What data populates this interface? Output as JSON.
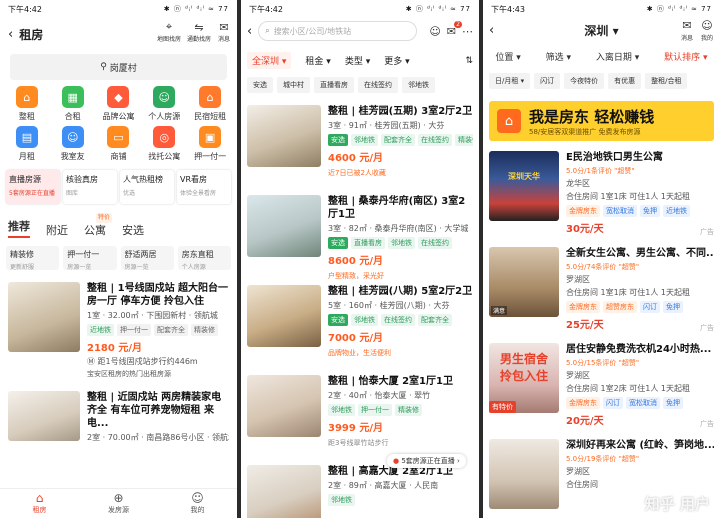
{
  "left": {
    "status": {
      "time": "下午4:42",
      "signal": "✱ ⓝ ᵈᵢˡ ᵈᵢˡ ≈ 77"
    },
    "title": "租房",
    "actions": [
      {
        "label": "地图找房"
      },
      {
        "label": "通勤找房"
      },
      {
        "label": "消息"
      }
    ],
    "search_text": "岗厦村",
    "categories": [
      {
        "label": "整租",
        "color": "#ff8a1f"
      },
      {
        "label": "合租",
        "color": "#3bbf5a"
      },
      {
        "label": "品牌公寓",
        "color": "#ff5a3a"
      },
      {
        "label": "个人房源",
        "color": "#2eaa5e"
      },
      {
        "label": "民宿短租",
        "color": "#ff7a2a"
      },
      {
        "label": "月租",
        "color": "#3d8ff5"
      },
      {
        "label": "我室友",
        "color": "#3d8ff5"
      },
      {
        "label": "商铺",
        "color": "#ff8a1f"
      },
      {
        "label": "找托公寓",
        "color": "#ff5a3a"
      },
      {
        "label": "押一付一",
        "color": "#ff8a1f"
      }
    ],
    "promo_cards": [
      {
        "title": "直播房源",
        "sub": "5套房源正在直播",
        "bg": "#ffe9ea"
      },
      {
        "title": "核验真房",
        "sub": "图库",
        "bg": "#fff"
      },
      {
        "title": "人气热租榜",
        "sub": "优选",
        "bg": "#fff"
      },
      {
        "title": "VR看房",
        "sub": "体验全景看房",
        "bg": "#fff"
      }
    ],
    "tabs": [
      {
        "label": "推荐"
      },
      {
        "label": "附近"
      },
      {
        "label": "公寓",
        "badge": "特价"
      },
      {
        "label": "安选"
      }
    ],
    "filters": [
      {
        "title": "精装修",
        "sub": "更新舒服"
      },
      {
        "title": "押一付一",
        "sub": "房源一览"
      },
      {
        "title": "舒适两居",
        "sub": "房源一览"
      },
      {
        "title": "房东直租",
        "sub": "个人房源"
      }
    ],
    "listings": [
      {
        "title": "整租 | 1号线固戍站  超大阳台一房一厅 停车方便 拎包入住",
        "meta": "1室 · 32.00㎡ · 下围园新村 · 领航城",
        "tags": [
          "近地铁",
          "押一付一",
          "配套齐全",
          "精装修"
        ],
        "price": "2180 元/月",
        "distance": "距1号线固戍站步行约446m",
        "note": "宝安区租房的热门出租房源"
      },
      {
        "title": "整租 | 近固戍站 两房精装家电齐全 有车位可养宠物短租 来电...",
        "meta": "2室 · 70.00㎡ · 南昌路86号小区 · 领航城",
        "tags": [],
        "price": "",
        "distance": "",
        "note": ""
      }
    ],
    "bottom_nav": [
      {
        "label": "租房",
        "icon": "⌂"
      },
      {
        "label": "发房源",
        "icon": "⊕"
      },
      {
        "label": "我的",
        "icon": "☺"
      }
    ]
  },
  "middle": {
    "status": {
      "time": "下午4:42",
      "signal": "✱ ⓝ ᵈᵢˡ ᵈᵢˡ ≈ 77"
    },
    "search_placeholder": "搜索小区/公司/地铁站",
    "msg_badge": "2",
    "filters": [
      {
        "label": "全深圳"
      },
      {
        "label": "租金"
      },
      {
        "label": "类型"
      },
      {
        "label": "更多"
      }
    ],
    "quick": [
      {
        "label": "安选"
      },
      {
        "label": "城中村"
      },
      {
        "label": "直播看房"
      },
      {
        "label": "在线签约"
      },
      {
        "label": "邻地铁"
      }
    ],
    "listings": [
      {
        "title": "整租 | 桂芳园(五期) 3室2厅2卫",
        "meta": "3室 · 91㎡ · 桂芳园(五期) · 大芬",
        "tags": [
          "安选",
          "邻地铁",
          "配套齐全",
          "在线签约",
          "精装修"
        ],
        "price": "4600 元/月",
        "note": "近7日已被2人收藏",
        "note_color": "#ff6a1f"
      },
      {
        "title": "整租 | 桑泰丹华府(南区) 3室2厅1卫",
        "meta": "3室 · 82㎡ · 桑泰丹华府(南区) · 大学城",
        "tags": [
          "安选",
          "直播看房",
          "邻地铁",
          "在线签约"
        ],
        "price": "8600 元/月",
        "note": "户型精致，采光好",
        "note_color": "#ff6a1f"
      },
      {
        "title": "整租 | 桂芳园(八期) 5室2厅2卫",
        "meta": "5室 · 160㎡ · 桂芳园(八期) · 大芬",
        "tags": [
          "安选",
          "邻地铁",
          "在线签约",
          "配套齐全"
        ],
        "price": "7000 元/月",
        "note": "品牌物业，生活便利",
        "note_color": "#ff6a1f"
      },
      {
        "title": "整租 | 怡泰大厦 2室1厅1卫",
        "meta": "2室 · 40㎡ · 怡泰大厦 · 翠竹",
        "tags": [
          "邻地铁",
          "押一付一",
          "精装修"
        ],
        "price": "3999 元/月",
        "note": "距3号线翠竹站步行",
        "note_color": "#888"
      },
      {
        "title": "整租 | 高嘉大厦 2室2厅1卫",
        "meta": "2室 · 89㎡ · 高嘉大厦 · 人民南",
        "tags": [
          "邻地铁"
        ],
        "price": "",
        "note": "",
        "note_color": "#888"
      }
    ],
    "live_float": "5套房源正在直播 ›"
  },
  "right": {
    "status": {
      "time": "下午4:43",
      "signal": "✱ ⓝ ᵈᵢˡ ᵈᵢˡ ≈ 77"
    },
    "city": "深圳 ▾",
    "actions": [
      {
        "label": "消息"
      },
      {
        "label": "我的"
      }
    ],
    "filters": [
      {
        "label": "位置 ▾"
      },
      {
        "label": "筛选 ▾"
      },
      {
        "label": "入离日期 ▾"
      },
      {
        "label": "默认排序 ▾",
        "active": true
      }
    ],
    "quick": [
      {
        "label": "日/月租 ▾"
      },
      {
        "label": "闪订"
      },
      {
        "label": "今夜特价"
      },
      {
        "label": "有优惠"
      },
      {
        "label": "整租/合租"
      }
    ],
    "banner": {
      "title": "我是房东  轻松赚钱",
      "sub": "58/安居客双渠道推广  免费发布房源"
    },
    "listings": [
      {
        "title": "E民治地铁口男生公寓",
        "rating": "5.0分/1条评价 \"超赞\"",
        "area": "龙华区",
        "meta": "合住房间 1室1床 可住1人 1天起租",
        "tags": [
          "金牌房东",
          "宽松取消",
          "免押",
          "近地铁"
        ],
        "price": "30元/天"
      },
      {
        "title": "全新女生公寓、男生公寓、不同...",
        "rating": "5.0分/74条评价 \"超赞\"",
        "area": "罗湖区",
        "meta": "合住房间 1室1床 可住1人 1天起租",
        "tags": [
          "金牌房东",
          "超赞房东",
          "闪订",
          "免押"
        ],
        "price": "25元/天"
      },
      {
        "title": "居住安静免费洗衣机24小时热...",
        "rating": "5.0分/15条评价 \"超赞\"",
        "area": "罗湖区",
        "meta": "合住房间 1室2床 可住1人 1天起租",
        "tags": [
          "金牌房东",
          "闪订",
          "宽松取消",
          "免押"
        ],
        "price": "20元/天"
      },
      {
        "title": "深圳好再来公寓 (红岭、笋岗地...",
        "rating": "5.0分/19条评价 \"超赞\"",
        "area": "罗湖区",
        "meta": "合住房间",
        "tags": [],
        "price": ""
      }
    ],
    "ad_label": "广告",
    "tag_sale": "有特价",
    "thumb_text1": "深圳天华",
    "thumb_text3": "男生宿舍 拎包入住",
    "vr_label": "满意",
    "watermark": "知乎 用户"
  }
}
